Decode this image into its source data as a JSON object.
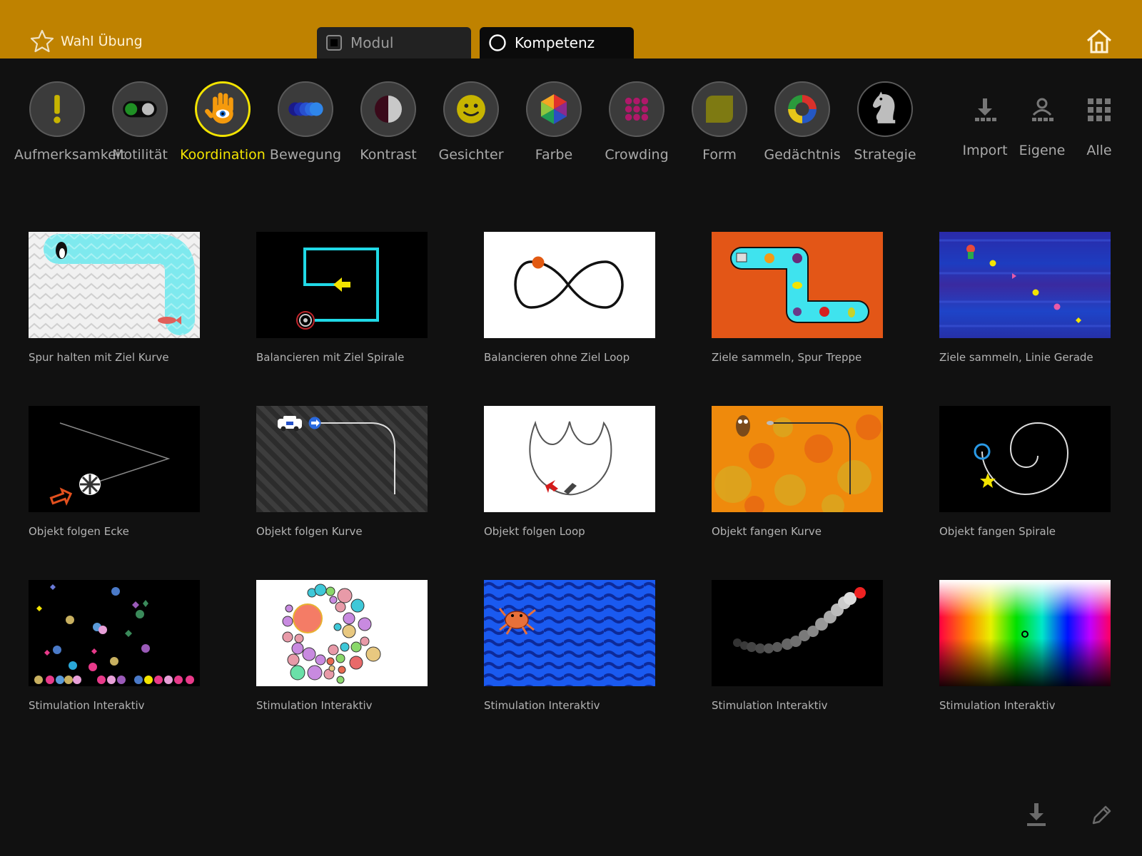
{
  "header": {
    "wahl_label": "Wahl Übung",
    "tabs": [
      {
        "label": "Modul",
        "active": false
      },
      {
        "label": "Kompetenz",
        "active": true
      }
    ],
    "home_icon": "home-icon"
  },
  "categories": [
    {
      "label": "Aufmerksamkeit",
      "icon": "exclamation-icon"
    },
    {
      "label": "Motilität",
      "icon": "toggle-icon"
    },
    {
      "label": "Koordination",
      "icon": "hand-eye-icon",
      "active": true
    },
    {
      "label": "Bewegung",
      "icon": "motion-dots-icon"
    },
    {
      "label": "Kontrast",
      "icon": "contrast-icon"
    },
    {
      "label": "Gesichter",
      "icon": "smiley-icon"
    },
    {
      "label": "Farbe",
      "icon": "color-hexagon-icon"
    },
    {
      "label": "Crowding",
      "icon": "dot-grid-icon"
    },
    {
      "label": "Form",
      "icon": "rounded-square-icon"
    },
    {
      "label": "Gedächtnis",
      "icon": "color-ring-icon"
    },
    {
      "label": "Strategie",
      "icon": "chess-knight-icon"
    }
  ],
  "tools": [
    {
      "label": "Import",
      "icon": "import-icon"
    },
    {
      "label": "Eigene",
      "icon": "user-group-icon"
    },
    {
      "label": "Alle",
      "icon": "grid-icon"
    }
  ],
  "exercises": [
    {
      "title": "Spur halten mit Ziel Kurve"
    },
    {
      "title": "Balancieren mit Ziel Spirale"
    },
    {
      "title": "Balancieren ohne Ziel Loop"
    },
    {
      "title": "Ziele sammeln, Spur Treppe"
    },
    {
      "title": "Ziele sammeln, Linie Gerade"
    },
    {
      "title": "Objekt folgen Ecke"
    },
    {
      "title": "Objekt folgen Kurve"
    },
    {
      "title": "Objekt folgen Loop"
    },
    {
      "title": "Objekt fangen Kurve"
    },
    {
      "title": "Objekt fangen Spirale"
    },
    {
      "title": "Stimulation Interaktiv"
    },
    {
      "title": "Stimulation Interaktiv"
    },
    {
      "title": "Stimulation Interaktiv"
    },
    {
      "title": "Stimulation Interaktiv"
    },
    {
      "title": "Stimulation Interaktiv"
    }
  ],
  "footer": {
    "download_icon": "download-icon",
    "edit_icon": "pencil-icon"
  },
  "colors": {
    "header": "#bf8200",
    "background": "#111111",
    "active": "#f3e400"
  }
}
